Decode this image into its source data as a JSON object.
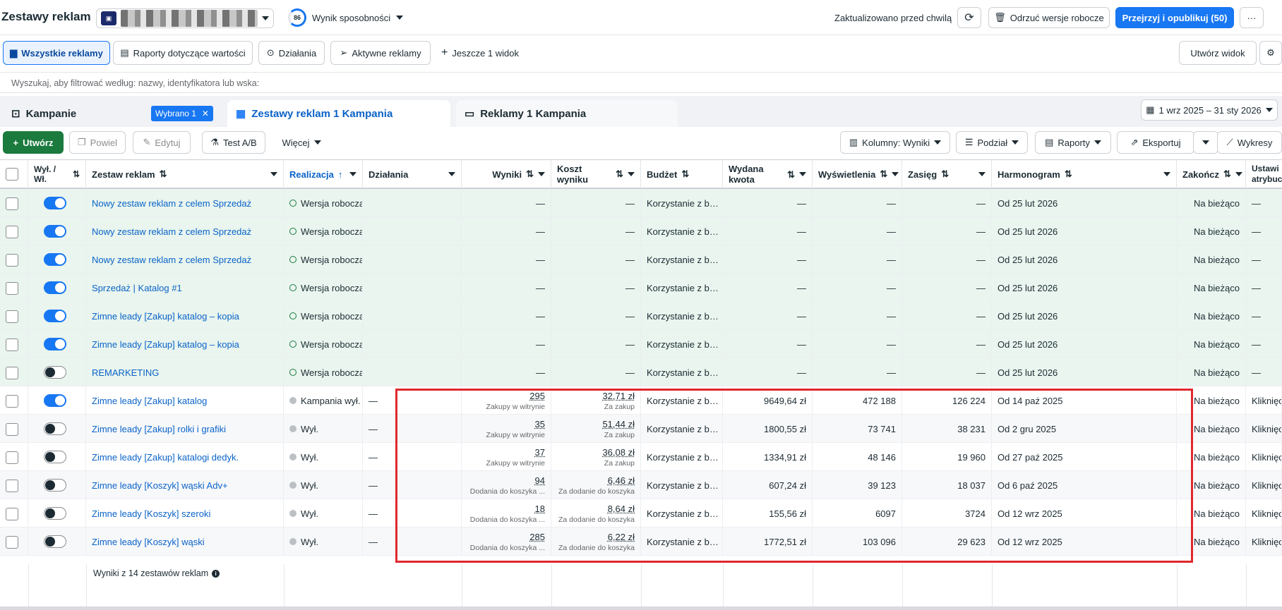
{
  "header": {
    "title": "Zestawy reklam",
    "score_value": "86",
    "score_label": "Wynik sposobności",
    "updated": "Zaktualizowano przed chwilą",
    "discard_label": "Odrzuć wersje robocze",
    "publish_label": "Przejrzyj i opublikuj (50)",
    "more_label": "···"
  },
  "views": {
    "all_ads": "Wszystkie reklamy",
    "value_reports": "Raporty dotyczące wartości",
    "actions": "Działania",
    "active_ads": "Aktywne reklamy",
    "more_view": "Jeszcze 1 widok",
    "create_view": "Utwórz widok"
  },
  "search": {
    "placeholder": "Wyszukaj, aby filtrować według: nazwy, identyfikatora lub wska:"
  },
  "tabs": {
    "campaigns": "Kampanie",
    "selected": "Wybrano 1",
    "adsets": "Zestawy reklam 1 Kampania",
    "ads": "Reklamy 1 Kampania",
    "date_range": "1 wrz 2025 – 31 sty 2026"
  },
  "toolbar": {
    "create": "Utwórz",
    "duplicate": "Powiel",
    "edit": "Edytuj",
    "abtest": "Test A/B",
    "more": "Więcej",
    "columns": "Kolumny: Wyniki",
    "breakdown": "Podział",
    "reports": "Raporty",
    "export": "Eksportuj",
    "charts": "Wykresy"
  },
  "columns": {
    "toggle": "Wył. / Wł.",
    "name": "Zestaw reklam",
    "delivery": "Realizacja",
    "actions": "Działania",
    "results": "Wyniki",
    "cost": "Koszt wyniku",
    "budget": "Budżet",
    "spent": "Wydana kwota",
    "impressions": "Wyświetlenia",
    "reach": "Zasięg",
    "schedule": "Harmonogram",
    "ends": "Zakończ",
    "attribution": "Ustawi atrybuc"
  },
  "rows": [
    {
      "on": true,
      "name": "Nowy zestaw reklam z celem Sprzedaż",
      "delivery": "Wersja robocza",
      "actions": "",
      "results": "—",
      "results_sub": "",
      "cost": "—",
      "cost_sub": "",
      "budget": "Korzystanie z b…",
      "spent": "—",
      "impressions": "—",
      "reach": "—",
      "schedule": "Od 25 lut 2026",
      "ends": "Na bieżąco",
      "attribution": "—"
    },
    {
      "on": true,
      "name": "Nowy zestaw reklam z celem Sprzedaż",
      "delivery": "Wersja robocza",
      "actions": "",
      "results": "—",
      "results_sub": "",
      "cost": "—",
      "cost_sub": "",
      "budget": "Korzystanie z b…",
      "spent": "—",
      "impressions": "—",
      "reach": "—",
      "schedule": "Od 25 lut 2026",
      "ends": "Na bieżąco",
      "attribution": "—"
    },
    {
      "on": true,
      "name": "Nowy zestaw reklam z celem Sprzedaż",
      "delivery": "Wersja robocza",
      "actions": "",
      "results": "—",
      "results_sub": "",
      "cost": "—",
      "cost_sub": "",
      "budget": "Korzystanie z b…",
      "spent": "—",
      "impressions": "—",
      "reach": "—",
      "schedule": "Od 25 lut 2026",
      "ends": "Na bieżąco",
      "attribution": "—"
    },
    {
      "on": true,
      "name": "Sprzedaż | Katalog #1",
      "delivery": "Wersja robocza",
      "actions": "",
      "results": "—",
      "results_sub": "",
      "cost": "—",
      "cost_sub": "",
      "budget": "Korzystanie z b…",
      "spent": "—",
      "impressions": "—",
      "reach": "—",
      "schedule": "Od 25 lut 2026",
      "ends": "Na bieżąco",
      "attribution": "—"
    },
    {
      "on": true,
      "name": "Zimne leady [Zakup] katalog – kopia",
      "delivery": "Wersja robocza",
      "actions": "",
      "results": "—",
      "results_sub": "",
      "cost": "—",
      "cost_sub": "",
      "budget": "Korzystanie z b…",
      "spent": "—",
      "impressions": "—",
      "reach": "—",
      "schedule": "Od 25 lut 2026",
      "ends": "Na bieżąco",
      "attribution": "—"
    },
    {
      "on": true,
      "name": "Zimne leady [Zakup] katalog – kopia",
      "delivery": "Wersja robocza",
      "actions": "",
      "results": "—",
      "results_sub": "",
      "cost": "—",
      "cost_sub": "",
      "budget": "Korzystanie z b…",
      "spent": "—",
      "impressions": "—",
      "reach": "—",
      "schedule": "Od 25 lut 2026",
      "ends": "Na bieżąco",
      "attribution": "—"
    },
    {
      "on": false,
      "name": "REMARKETING",
      "delivery": "Wersja robocza",
      "actions": "",
      "results": "—",
      "results_sub": "",
      "cost": "—",
      "cost_sub": "",
      "budget": "Korzystanie z b…",
      "spent": "—",
      "impressions": "—",
      "reach": "—",
      "schedule": "Od 25 lut 2026",
      "ends": "Na bieżąco",
      "attribution": "—"
    },
    {
      "on": true,
      "name": "Zimne leady [Zakup] katalog",
      "delivery": "Kampania wył.",
      "actions": "—",
      "results": "295",
      "results_sub": "Zakupy w witrynie",
      "cost": "32,71 zł",
      "cost_sub": "Za zakup",
      "budget": "Korzystanie z b…",
      "spent": "9649,64 zł",
      "impressions": "472 188",
      "reach": "126 224",
      "schedule": "Od 14 paź 2025",
      "ends": "Na bieżąco",
      "attribution": "Kliknięc"
    },
    {
      "on": false,
      "name": "Zimne leady [Zakup] rolki i grafiki",
      "delivery": "Wył.",
      "actions": "—",
      "results": "35",
      "results_sub": "Zakupy w witrynie",
      "cost": "51,44 zł",
      "cost_sub": "Za zakup",
      "budget": "Korzystanie z b…",
      "spent": "1800,55 zł",
      "impressions": "73 741",
      "reach": "38 231",
      "schedule": "Od 2 gru 2025",
      "ends": "Na bieżąco",
      "attribution": "Kliknięc"
    },
    {
      "on": false,
      "name": "Zimne leady [Zakup] katalogi dedyk.",
      "delivery": "Wył.",
      "actions": "—",
      "results": "37",
      "results_sub": "Zakupy w witrynie",
      "cost": "36,08 zł",
      "cost_sub": "Za zakup",
      "budget": "Korzystanie z b…",
      "spent": "1334,91 zł",
      "impressions": "48 146",
      "reach": "19 960",
      "schedule": "Od 27 paź 2025",
      "ends": "Na bieżąco",
      "attribution": "Kliknięc"
    },
    {
      "on": false,
      "name": "Zimne leady [Koszyk] wąski Adv+",
      "delivery": "Wył.",
      "actions": "—",
      "results": "94",
      "results_sub": "Dodania do koszyka ...",
      "cost": "6,46 zł",
      "cost_sub": "Za dodanie do koszyka",
      "budget": "Korzystanie z b…",
      "spent": "607,24 zł",
      "impressions": "39 123",
      "reach": "18 037",
      "schedule": "Od 6 paź 2025",
      "ends": "Na bieżąco",
      "attribution": "Kliknięc"
    },
    {
      "on": false,
      "name": "Zimne leady [Koszyk] szeroki",
      "delivery": "Wył.",
      "actions": "—",
      "results": "18",
      "results_sub": "Dodania do koszyka ...",
      "cost": "8,64 zł",
      "cost_sub": "Za dodanie do koszyka",
      "budget": "Korzystanie z b…",
      "spent": "155,56 zł",
      "impressions": "6097",
      "reach": "3724",
      "schedule": "Od 12 wrz 2025",
      "ends": "Na bieżąco",
      "attribution": "Kliknięc"
    },
    {
      "on": false,
      "name": "Zimne leady [Koszyk] wąski",
      "delivery": "Wył.",
      "actions": "—",
      "results": "285",
      "results_sub": "Dodania do koszyka ...",
      "cost": "6,22 zł",
      "cost_sub": "Za dodanie do koszyka",
      "budget": "Korzystanie z b…",
      "spent": "1772,51 zł",
      "impressions": "103 096",
      "reach": "29 623",
      "schedule": "Od 12 wrz 2025",
      "ends": "Na bieżąco",
      "attribution": "Kliknięc"
    }
  ],
  "footer": {
    "summary": "Wyniki z 14 zestawów reklam"
  },
  "colors": {
    "accent": "#1877f2",
    "create_green": "#1b7a3e",
    "draft_bg": "#e9f5ee",
    "highlight": "#e0282e"
  }
}
